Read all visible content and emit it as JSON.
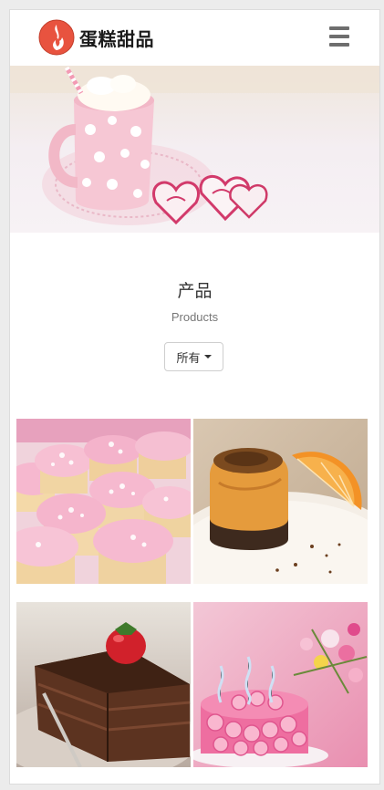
{
  "header": {
    "brand": "蛋糕甜品",
    "logo_icon": "flame-logo-icon",
    "menu_icon": "hamburger-menu-icon"
  },
  "banner": {
    "image": "pink-polka-dot-mug-with-heart-cookies"
  },
  "section": {
    "title": "产品",
    "subtitle": "Products",
    "filter_label": "所有"
  },
  "products": [
    {
      "image": "pink-frosted-cupcakes"
    },
    {
      "image": "orange-cake-with-orange-slice"
    },
    {
      "image": "chocolate-cake-slice-with-strawberry"
    },
    {
      "image": "pink-rose-cake-with-candles"
    }
  ],
  "colors": {
    "logo_red": "#e8533f",
    "menu_gray": "#6e6e6e",
    "pink_accent": "#f2a6c0"
  }
}
